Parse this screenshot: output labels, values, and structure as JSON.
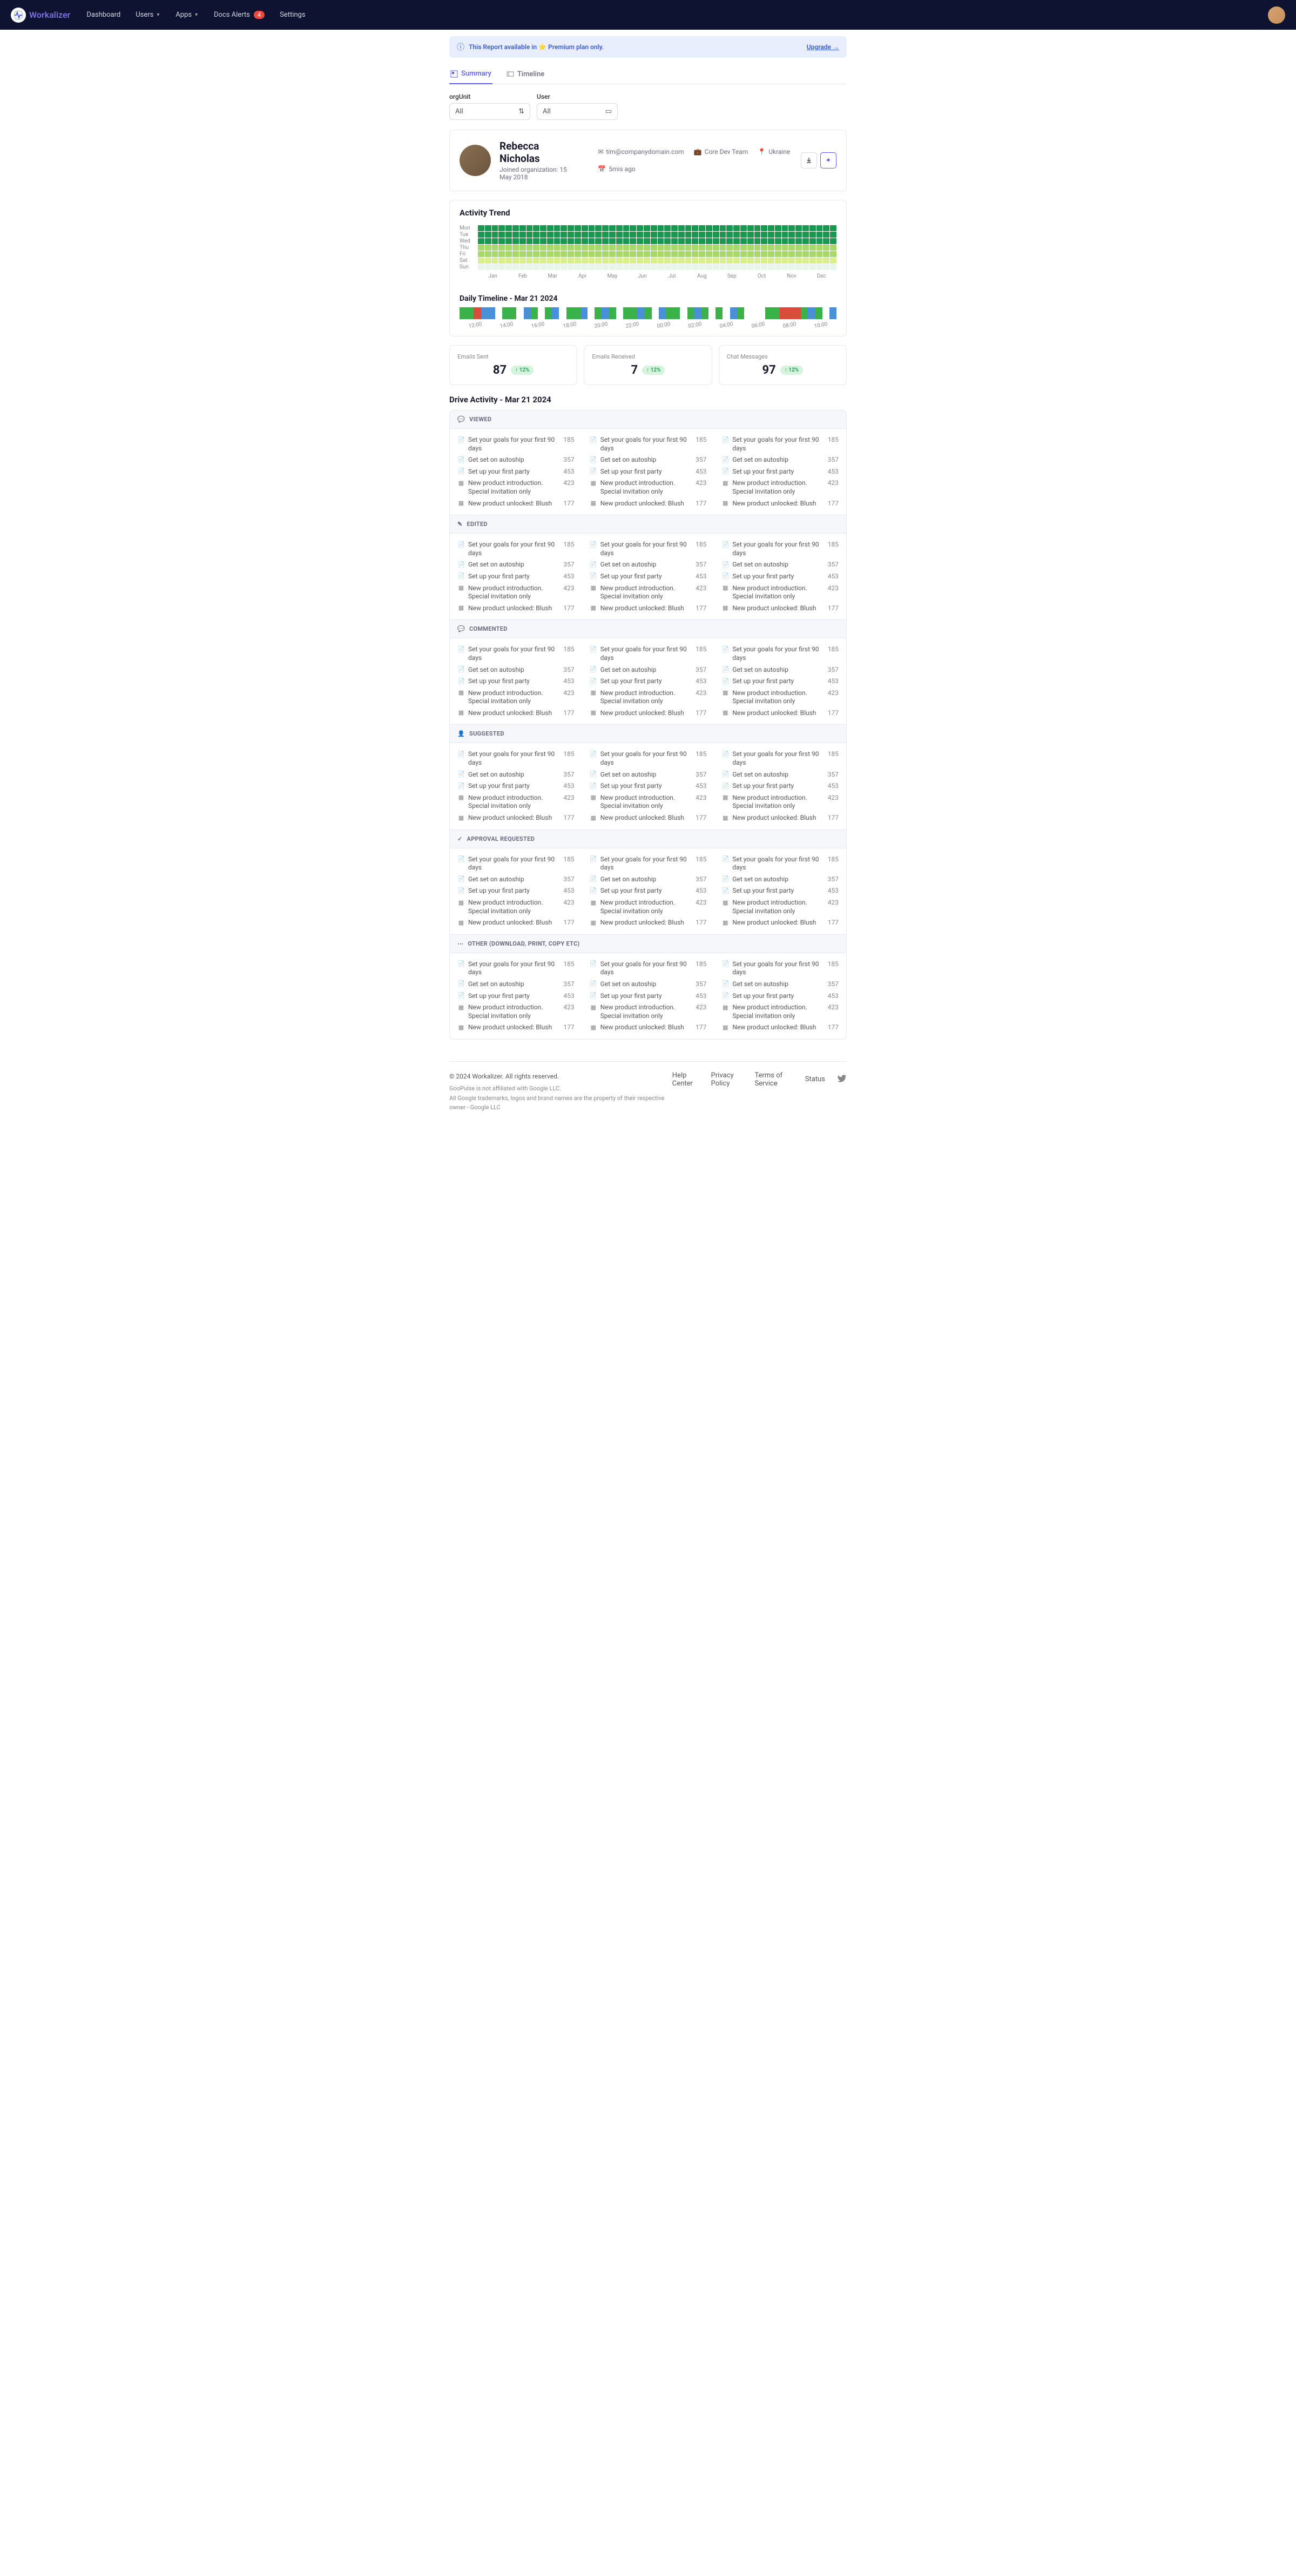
{
  "brand": "Workalizer",
  "nav": {
    "dashboard": "Dashboard",
    "users": "Users",
    "apps": "Apps",
    "docs": "Docs Alerts",
    "docs_badge": "4",
    "settings": "Settings"
  },
  "banner": {
    "text": "This Report available in ⭐ Premium plan only.",
    "upgrade": "Upgrade →"
  },
  "tabs": {
    "summary": "Summary",
    "timeline": "Timeline"
  },
  "filters": {
    "org_label": "orgUnit",
    "org_value": "All",
    "user_label": "User",
    "user_value": "All"
  },
  "profile": {
    "name": "Rebecca Nicholas",
    "joined": "Joined organization: 15 May 2018",
    "email": "tim@companydomain.com",
    "team": "Core Dev Team",
    "location": "Ukraine",
    "age": "5mis ago"
  },
  "activity": {
    "title": "Activity Trend",
    "days": [
      "Mon",
      "Tue",
      "Wed",
      "Thu",
      "Fri",
      "Sat",
      "Sun"
    ],
    "months": [
      "Jan",
      "Feb",
      "Mar",
      "Apr",
      "May",
      "Jun",
      "Jul",
      "Aug",
      "Sep",
      "Oct",
      "Nov",
      "Dec"
    ]
  },
  "timeline": {
    "title": "Daily Timeline - Mar 21 2024",
    "hours": [
      "12:00",
      "14:00",
      "16:00",
      "18:00",
      "20:00",
      "22:00",
      "00:00",
      "02:00",
      "04:00",
      "06:00",
      "08:00",
      "10:00"
    ]
  },
  "stats": {
    "sent": {
      "label": "Emails Sent",
      "value": "87",
      "trend": "↑ 12%"
    },
    "recv": {
      "label": "Emails Received",
      "value": "7",
      "trend": "↑ 12%"
    },
    "chat": {
      "label": "Chat Messages",
      "value": "97",
      "trend": "↑ 12%"
    }
  },
  "drive": {
    "title": "Drive Activity - Mar 21 2024",
    "sections": [
      "VIEWED",
      "EDITED",
      "COMMENTED",
      "SUGGESTED",
      "APPROVAL REQUESTED",
      "OTHER (DOWNLOAD, PRINT, COPY ETC)"
    ],
    "files": [
      {
        "n": "Set your goals for your first 90 days",
        "c": "185"
      },
      {
        "n": "Get set on autoship",
        "c": "357"
      },
      {
        "n": "Set up your first party",
        "c": "453"
      },
      {
        "n": "New product introduction. Special invitation only",
        "c": "423"
      },
      {
        "n": "New product unlocked: Blush",
        "c": "177"
      }
    ]
  },
  "footer": {
    "copy": "© 2024 Workalizer. All rights reserved.",
    "d1": "GooPulse is not affiliated with Google LLC.",
    "d2": "All Google trademarks, logos and brand names are the property of their respective owner - Google LLC",
    "links": [
      "Help Center",
      "Privacy Policy",
      "Terms of Service",
      "Status"
    ]
  }
}
